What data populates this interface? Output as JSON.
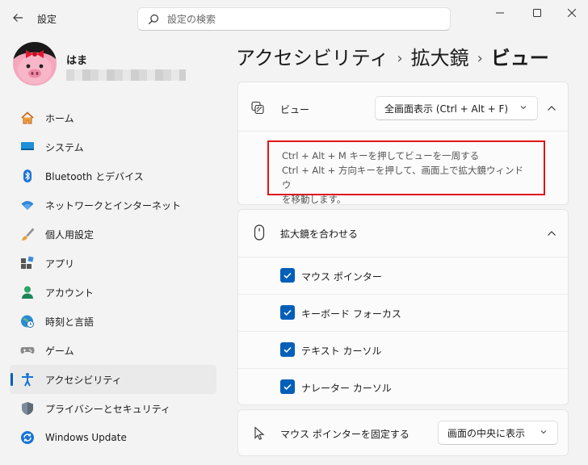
{
  "app": {
    "title": "設定",
    "back_icon": "back-arrow-icon"
  },
  "search": {
    "placeholder": "設定の検索",
    "value": ""
  },
  "window_controls": {
    "minimize": "—",
    "maximize": "☐",
    "close": "✕"
  },
  "profile": {
    "name": "はま",
    "email_redacted": true
  },
  "sidebar": {
    "items": [
      {
        "label": "ホーム",
        "icon": "home-icon",
        "active": false
      },
      {
        "label": "システム",
        "icon": "system-icon",
        "active": false
      },
      {
        "label": "Bluetooth とデバイス",
        "icon": "bluetooth-icon",
        "active": false
      },
      {
        "label": "ネットワークとインターネット",
        "icon": "wifi-icon",
        "active": false
      },
      {
        "label": "個人用設定",
        "icon": "brush-icon",
        "active": false
      },
      {
        "label": "アプリ",
        "icon": "apps-icon",
        "active": false
      },
      {
        "label": "アカウント",
        "icon": "account-icon",
        "active": false
      },
      {
        "label": "時刻と言語",
        "icon": "globe-clock-icon",
        "active": false
      },
      {
        "label": "ゲーム",
        "icon": "gamepad-icon",
        "active": false
      },
      {
        "label": "アクセシビリティ",
        "icon": "accessibility-icon",
        "active": true
      },
      {
        "label": "プライバシーとセキュリティ",
        "icon": "shield-icon",
        "active": false
      },
      {
        "label": "Windows Update",
        "icon": "windows-update-icon",
        "active": false
      }
    ]
  },
  "breadcrumb": {
    "level1": "アクセシビリティ",
    "sep": "›",
    "level2": "拡大鏡",
    "current": "ビュー"
  },
  "view_card": {
    "label": "ビュー",
    "dropdown_value": "全画面表示 (Ctrl + Alt + F)",
    "description_line1": "Ctrl + Alt + M キーを押してビューを一周する",
    "description_line2": "Ctrl + Alt + 方向キーを押して、画面上で拡大鏡ウィンドウ",
    "description_line3": "を移動します。"
  },
  "follow_card": {
    "label": "拡大鏡を合わせる",
    "options": [
      {
        "label": "マウス ポインター",
        "checked": true
      },
      {
        "label": "キーボード フォーカス",
        "checked": true
      },
      {
        "label": "テキスト カーソル",
        "checked": true
      },
      {
        "label": "ナレーター カーソル",
        "checked": true
      }
    ]
  },
  "pointer_card": {
    "label": "マウス ポインターを固定する",
    "dropdown_value": "画面の中央に表示"
  },
  "colors": {
    "accent": "#005fb8",
    "highlight_border": "#e0161b"
  }
}
